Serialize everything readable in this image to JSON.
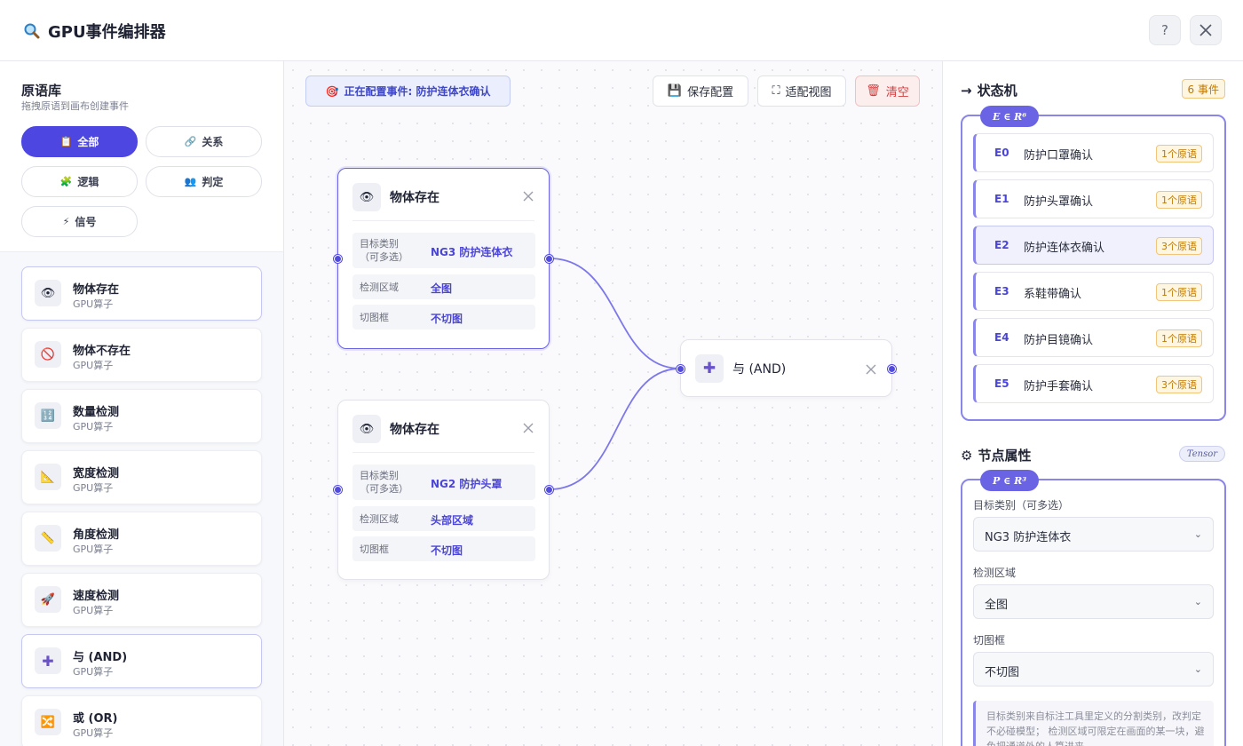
{
  "header": {
    "title": "GPU事件编排器",
    "help_label": "?"
  },
  "library": {
    "title": "原语库",
    "subtitle": "拖拽原语到画布创建事件",
    "filters": [
      {
        "icon": "📋",
        "label": "全部"
      },
      {
        "icon": "🔗",
        "label": "关系"
      },
      {
        "icon": "🧩",
        "label": "逻辑"
      },
      {
        "icon": "👥",
        "label": "判定"
      },
      {
        "icon": "⚡",
        "label": "信号"
      }
    ],
    "operators": [
      {
        "icon": "👁",
        "name": "物体存在",
        "sub": "GPU算子"
      },
      {
        "icon": "🚫",
        "name": "物体不存在",
        "sub": "GPU算子"
      },
      {
        "icon": "🔢",
        "name": "数量检测",
        "sub": "GPU算子"
      },
      {
        "icon": "📐",
        "name": "宽度检测",
        "sub": "GPU算子"
      },
      {
        "icon": "📏",
        "name": "角度检测",
        "sub": "GPU算子"
      },
      {
        "icon": "🚀",
        "name": "速度检测",
        "sub": "GPU算子"
      },
      {
        "icon": "✚",
        "name": "与 (AND)",
        "sub": "GPU算子"
      },
      {
        "icon": "🔀",
        "name": "或 (OR)",
        "sub": "GPU算子"
      }
    ]
  },
  "canvas": {
    "config_tag": "正在配置事件: 防护连体衣确认",
    "config_icon": "🎯",
    "save_label": "保存配置",
    "save_icon": "💾",
    "fit_label": "适配视图",
    "fit_icon": "⛶",
    "clear_label": "清空",
    "clear_icon": "🗑",
    "nodes": [
      {
        "icon": "👁",
        "title": "物体存在",
        "rows": [
          {
            "label": "目标类别\n（可多选）",
            "value": "NG3 防护连体衣"
          },
          {
            "label": "检测区域",
            "value": "全图"
          },
          {
            "label": "切图框",
            "value": "不切图"
          }
        ]
      },
      {
        "icon": "👁",
        "title": "物体存在",
        "rows": [
          {
            "label": "目标类别\n（可多选）",
            "value": "NG2 防护头罩"
          },
          {
            "label": "检测区域",
            "value": "头部区域"
          },
          {
            "label": "切图框",
            "value": "不切图"
          }
        ]
      },
      {
        "icon": "✚",
        "title": "与 (AND)"
      }
    ]
  },
  "state_machine": {
    "title": "状态机",
    "arrow": "→",
    "count_badge": "6 事件",
    "math_label": "E ∈ R⁶",
    "events": [
      {
        "id": "E0",
        "name": "防护口罩确认",
        "badge": "1个原语"
      },
      {
        "id": "E1",
        "name": "防护头罩确认",
        "badge": "1个原语"
      },
      {
        "id": "E2",
        "name": "防护连体衣确认",
        "badge": "3个原语"
      },
      {
        "id": "E3",
        "name": "系鞋带确认",
        "badge": "1个原语"
      },
      {
        "id": "E4",
        "name": "防护目镜确认",
        "badge": "1个原语"
      },
      {
        "id": "E5",
        "name": "防护手套确认",
        "badge": "3个原语"
      }
    ]
  },
  "node_props": {
    "title": "节点属性",
    "icon": "⚙",
    "tensor_badge": "Tensor",
    "math_label": "P ∈ R³",
    "fields": [
      {
        "label": "目标类别（可多选）",
        "value": "NG3 防护连体衣"
      },
      {
        "label": "检测区域",
        "value": "全图"
      },
      {
        "label": "切图框",
        "value": "不切图"
      }
    ],
    "note": "目标类别来自标注工具里定义的分割类别，改判定不必碰模型； 检测区域可限定在画面的某一块，避免把通道外的人算进来。"
  },
  "colors": {
    "accent": "#4d46e0",
    "edge": "#7d78ea",
    "badge": "#c07800",
    "danger": "#d23e3e"
  }
}
